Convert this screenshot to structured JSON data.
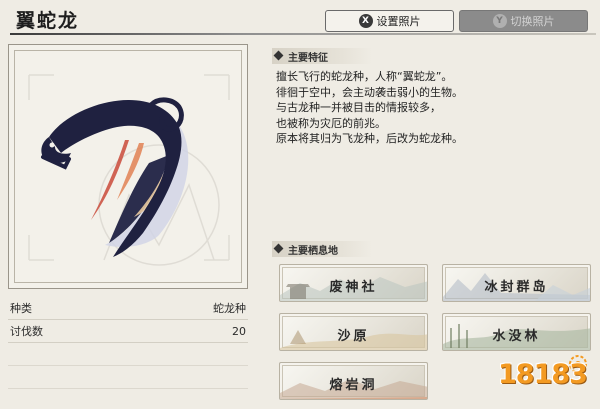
{
  "header": {
    "title": "翼蛇龙",
    "set_photo": {
      "key": "X",
      "label": "设置照片"
    },
    "switch_photo": {
      "key": "Y",
      "label": "切换照片"
    }
  },
  "stats": [
    {
      "label": "种类",
      "value": "蛇龙种"
    },
    {
      "label": "讨伐数",
      "value": "20"
    }
  ],
  "features": {
    "heading": "主要特征",
    "lines": [
      "擅长飞行的蛇龙种，人称“翼蛇龙”。",
      "徘徊于空中，会主动袭击弱小的生物。",
      "与古龙种一并被目击的情报较多，",
      "也被称为灾厄的前兆。",
      "原本将其归为飞龙种，后改为蛇龙种。"
    ]
  },
  "habitats": {
    "heading": "主要栖息地",
    "items": [
      {
        "name": "废神社"
      },
      {
        "name": "冰封群岛"
      },
      {
        "name": "沙原"
      },
      {
        "name": "水没林"
      },
      {
        "name": "熔岩洞"
      }
    ]
  },
  "watermark": {
    "text": "18183"
  },
  "colors": {
    "background": "#efece4",
    "monster_body": "#1f2140",
    "monster_accent": "#c94a3a",
    "disabled_button": "#8b8b8b",
    "watermark": "#f39a22"
  }
}
